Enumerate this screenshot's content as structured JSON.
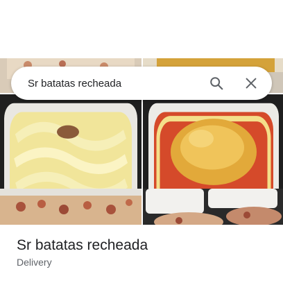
{
  "search": {
    "query": "Sr batatas recheada",
    "search_icon": "search-icon",
    "close_icon": "close-icon"
  },
  "place": {
    "title": "Sr batatas recheada",
    "category": "Delivery"
  },
  "colors": {
    "text_primary": "#202124",
    "text_secondary": "#5f6368",
    "icon": "#5f6368"
  }
}
